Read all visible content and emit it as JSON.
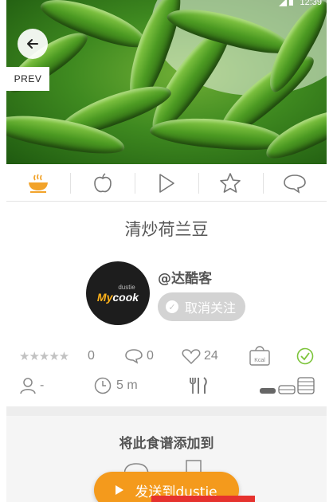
{
  "status_bar": {
    "time": "12:39"
  },
  "nav": {
    "prev_label": "PREV"
  },
  "tabs": [
    {
      "icon": "cooking-pot-icon",
      "active": true
    },
    {
      "icon": "apple-icon",
      "active": false
    },
    {
      "icon": "play-icon",
      "active": false
    },
    {
      "icon": "star-icon",
      "active": false
    },
    {
      "icon": "comment-icon",
      "active": false
    }
  ],
  "recipe": {
    "title": "清炒荷兰豆"
  },
  "author": {
    "username": "@达酷客",
    "avatar_small": "dustie",
    "avatar_brand_my": "My",
    "avatar_brand_cook": "cook",
    "unfollow_label": "取消关注"
  },
  "stats": {
    "rating_count": "0",
    "comment_count": "0",
    "like_count": "24",
    "kcal_label": "Kcal",
    "servings": "-",
    "time": "5 m"
  },
  "add_to": {
    "title": "将此食谱添加到",
    "send_label": "发送到dustie"
  },
  "colors": {
    "accent": "#f49a1c",
    "active_tab": "#f2a32a",
    "check": "#7cc43a"
  }
}
